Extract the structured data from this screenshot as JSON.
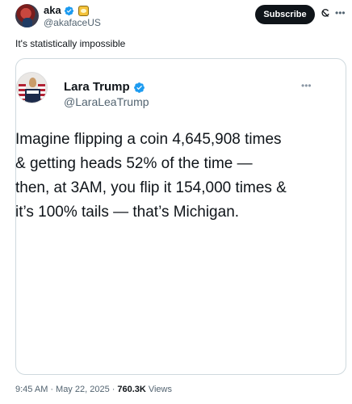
{
  "author": {
    "display_name": "aka",
    "handle": "@akafaceUS",
    "badges": [
      "verified-icon",
      "emoji-badge"
    ]
  },
  "actions": {
    "subscribe_label": "Subscribe",
    "grok_icon": "grok-icon",
    "more_icon": "more-icon"
  },
  "post": {
    "text": "It's statistically impossible"
  },
  "media": {
    "quoted": {
      "display_name": "Lara Trump",
      "handle": "@LaraLeaTrump",
      "body_lines": [
        "Imagine flipping a coin 4,645,908 times",
        "& getting heads 52% of the time —",
        "then, at 3AM, you flip it 154,000 times &",
        "it’s 100% tails — that’s Michigan."
      ]
    }
  },
  "meta": {
    "time": "9:45 AM",
    "separator": "·",
    "date": "May 22, 2025",
    "views_count": "760.3K",
    "views_label": "Views"
  },
  "colors": {
    "verified_blue": "#1d9bf0",
    "text_primary": "#0f1419",
    "text_secondary": "#536471",
    "border": "#cfd9de"
  }
}
